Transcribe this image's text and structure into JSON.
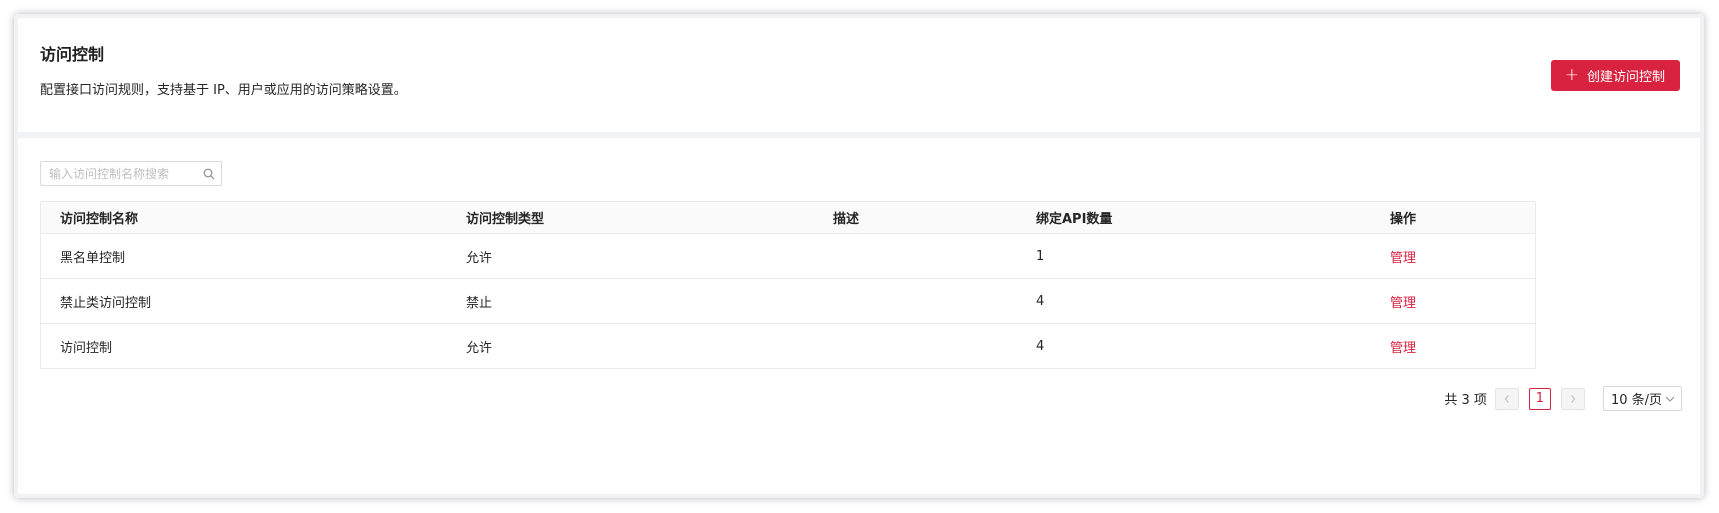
{
  "header": {
    "title": "访问控制",
    "description": "配置接口访问规则，支持基于 IP、用户或应用的访问策略设置。",
    "create_button": "创建访问控制"
  },
  "search": {
    "placeholder": "输入访问控制名称搜索"
  },
  "table": {
    "columns": [
      "访问控制名称",
      "访问控制类型",
      "描述",
      "绑定API数量",
      "操作"
    ],
    "rows": [
      {
        "name": "黑名单控制",
        "type": "允许",
        "desc": "",
        "api_count": "1",
        "action": "管理"
      },
      {
        "name": "禁止类访问控制",
        "type": "禁止",
        "desc": "",
        "api_count": "4",
        "action": "管理"
      },
      {
        "name": "访问控制",
        "type": "允许",
        "desc": "",
        "api_count": "4",
        "action": "管理"
      }
    ]
  },
  "pagination": {
    "total": "共 3 项",
    "current_page": "1",
    "page_size": "10 条/页"
  },
  "colors": {
    "accent": "#d9223f",
    "background": "#f0f2f5"
  },
  "icons": [
    "plus-icon",
    "search-icon",
    "chevron-left-icon",
    "chevron-right-icon",
    "chevron-down-icon"
  ]
}
